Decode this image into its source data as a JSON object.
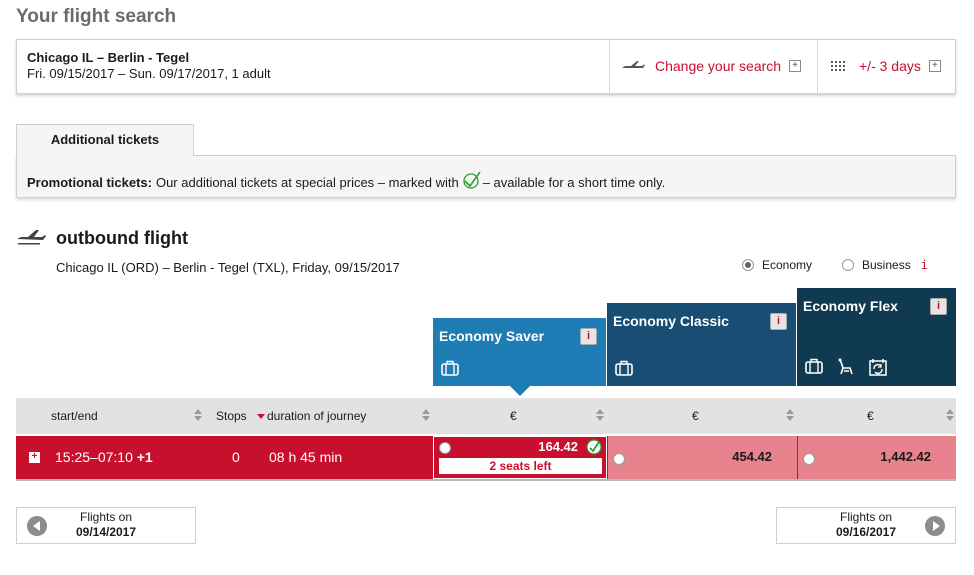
{
  "page": {
    "title": "Your flight search"
  },
  "search": {
    "route": "Chicago IL – Berlin - Tegel",
    "dates": "Fri. 09/15/2017 – Sun. 09/17/2017, 1 adult",
    "change_label": "Change your search",
    "days_label": "+/- 3 days"
  },
  "additional": {
    "tab_label": "Additional tickets",
    "promo_bold": "Promotional tickets:",
    "promo_text": "Our additional tickets at special prices – marked with",
    "promo_text_end": "– available for a short time only."
  },
  "outbound": {
    "title": "outbound flight",
    "subtitle": "Chicago IL (ORD) – Berlin - Tegel (TXL),  Friday, 09/15/2017",
    "cabin_options": [
      {
        "label": "Economy",
        "selected": true
      },
      {
        "label": "Business",
        "selected": false
      }
    ],
    "business_info": "i"
  },
  "fares": [
    {
      "name": "Economy Saver",
      "color": "#1e7db4",
      "info": "i",
      "icons": [
        "baggage-icon"
      ]
    },
    {
      "name": "Economy Classic",
      "color": "#1a4d73",
      "info": "i",
      "icons": [
        "baggage-icon"
      ]
    },
    {
      "name": "Economy Flex",
      "color": "#103a52",
      "info": "i",
      "icons": [
        "baggage-icon",
        "seat-icon",
        "rebooking-icon"
      ]
    }
  ],
  "table": {
    "headers": {
      "start_end": "start/end",
      "stops": "Stops",
      "duration": "duration of journey",
      "saver_currency": "€",
      "classic_currency": "€",
      "flex_currency": "€"
    },
    "rows": [
      {
        "expand": "+",
        "times": "15:25–07:10",
        "day_offset": "+1",
        "stops": "0",
        "duration": "08 h 45 min",
        "saver_price": "164.42",
        "saver_seats": "2 seats left",
        "classic_price": "454.42",
        "flex_price": "1,442.42"
      }
    ]
  },
  "nav": {
    "prev_line1": "Flights on",
    "prev_date": "09/14/2017",
    "next_line1": "Flights on",
    "next_date": "09/16/2017"
  },
  "colors": {
    "accent": "#c8102e",
    "row_light": "#e8828c",
    "header_gray": "#e2e2e2"
  }
}
